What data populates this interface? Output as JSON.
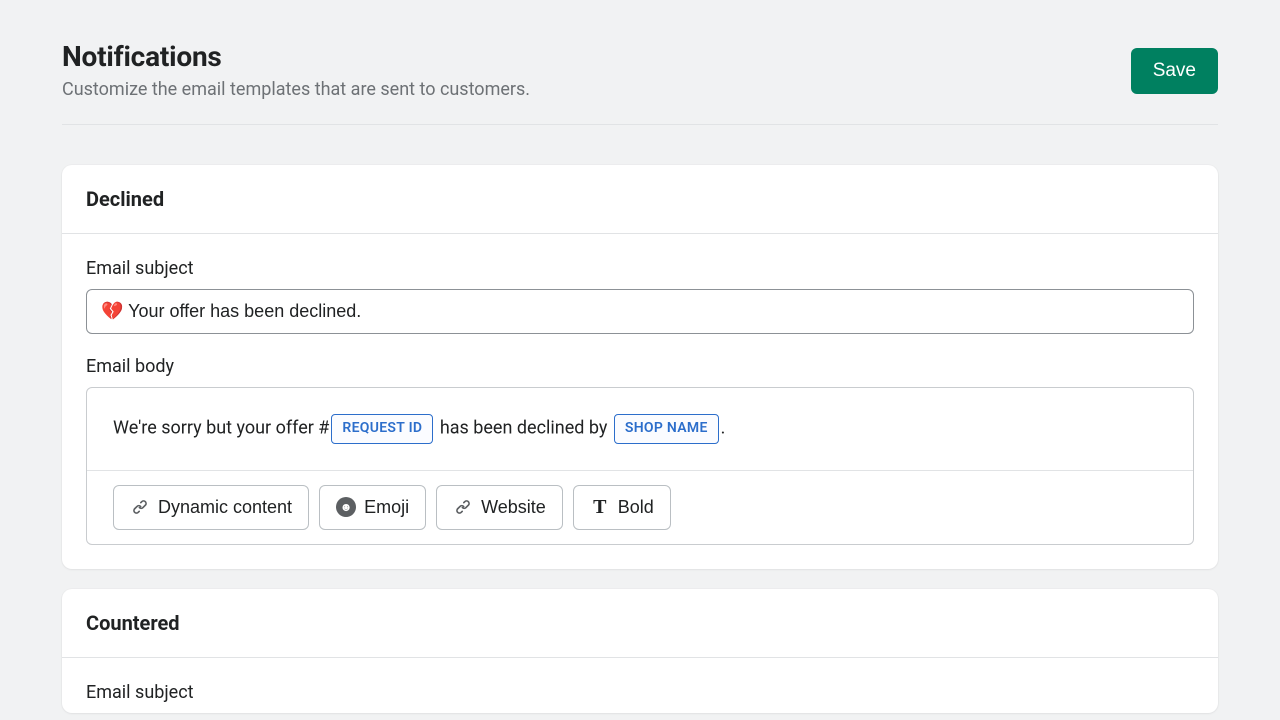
{
  "header": {
    "title": "Notifications",
    "subtitle": "Customize the email templates that are sent to customers.",
    "save_label": "Save"
  },
  "sections": {
    "declined": {
      "title": "Declined",
      "subject_label": "Email subject",
      "subject_value": "💔 Your offer has been declined.",
      "body_label": "Email body",
      "body_pre": "We're sorry but your offer #",
      "token_request_id": "REQUEST ID",
      "body_mid": " has been declined by ",
      "token_shop_name": "SHOP NAME",
      "body_post": "."
    },
    "countered": {
      "title": "Countered",
      "subject_label": "Email subject"
    }
  },
  "toolbar": {
    "dynamic_label": "Dynamic content",
    "emoji_label": "Emoji",
    "website_label": "Website",
    "bold_label": "Bold"
  }
}
